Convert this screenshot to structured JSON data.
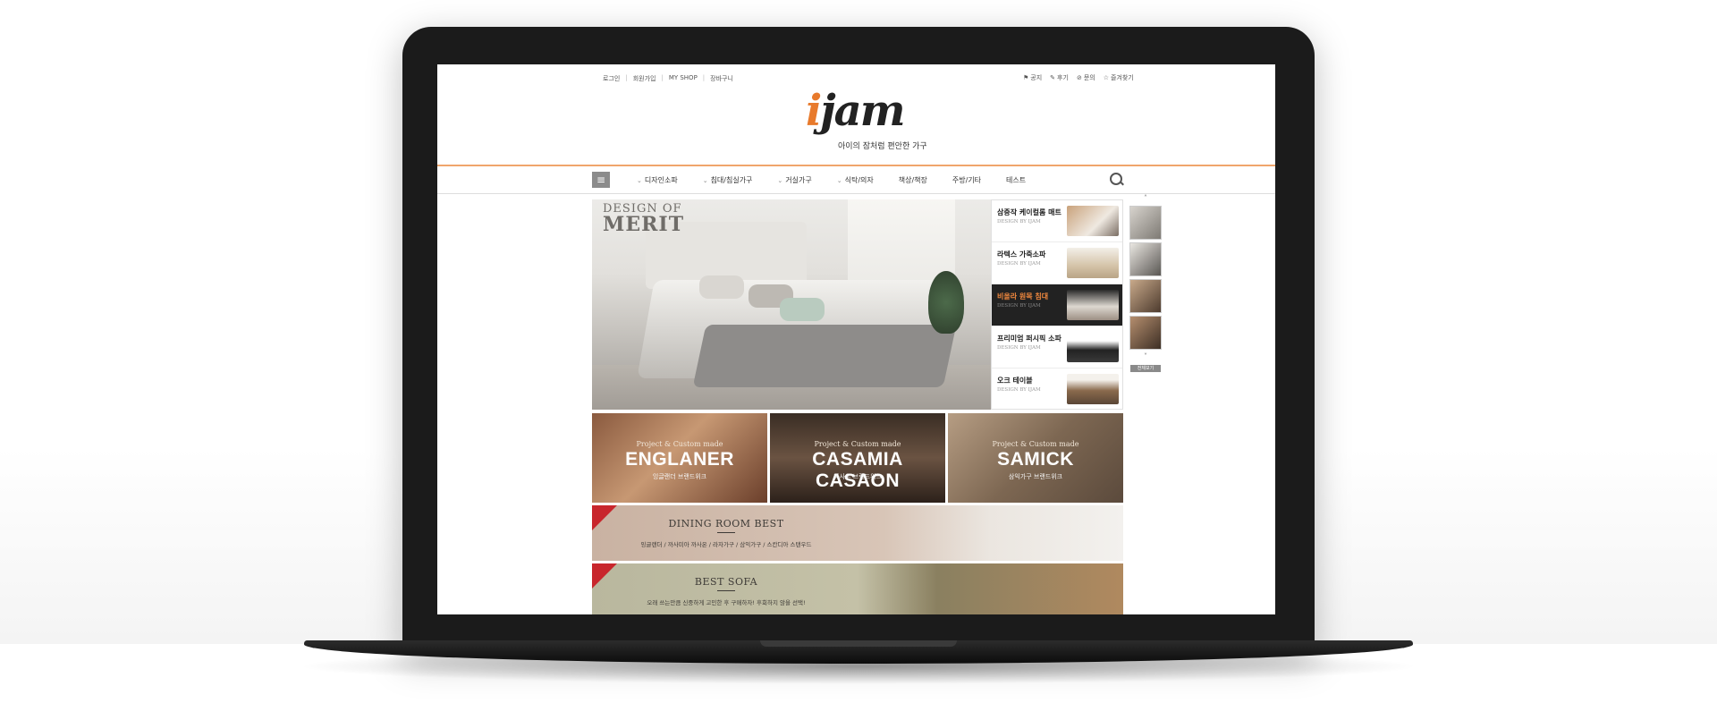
{
  "site": {
    "utility_links": [
      "로그인",
      "회원가입",
      "MY SHOP",
      "장바구니"
    ],
    "top_right": [
      {
        "icon": "notice-icon",
        "label": "공지"
      },
      {
        "icon": "pen-icon",
        "label": "후기"
      },
      {
        "icon": "clip-icon",
        "label": "문의"
      },
      {
        "icon": "star-icon",
        "label": "즐겨찾기"
      }
    ],
    "logo_text": "jam",
    "logo_i": "i",
    "logo_tagline": "아이의 잠처럼 편안한 가구",
    "nav": [
      "디자인소파",
      "침대/침실가구",
      "거실가구",
      "식탁/의자",
      "책상/책장",
      "주방/기타",
      "테스트"
    ],
    "nav_has_chevron": [
      true,
      true,
      true,
      true,
      false,
      false,
      false
    ],
    "hero": {
      "title_line1": "DESIGN OF",
      "title_line2": "MERIT"
    },
    "side_products": [
      {
        "name": "삼중작 케이컬롬 매트",
        "by": "DESIGN BY IJAM",
        "active": false
      },
      {
        "name": "라텍스 가죽소파",
        "by": "DESIGN BY IJAM",
        "active": false
      },
      {
        "name": "비올라 원목 침대",
        "by": "DESIGN BY IJAM",
        "active": true
      },
      {
        "name": "프리미엄 퍼시픽 소파",
        "by": "DESIGN BY IJAM",
        "active": false
      },
      {
        "name": "오크 테이블",
        "by": "DESIGN BY IJAM",
        "active": false
      }
    ],
    "thumb_button": "전체보기",
    "brands": [
      {
        "pre": "Project & Custom made",
        "name": "ENGLANER",
        "sub": "잉글랜더 브랜드위크"
      },
      {
        "pre": "Project & Custom made",
        "name": "CASAMIA CASAON",
        "sub": "까사온 브랜드위크"
      },
      {
        "pre": "Project & Custom made",
        "name": "SAMICK",
        "sub": "삼익가구 브랜드위크"
      }
    ],
    "banner1": {
      "title": "DINING ROOM BEST",
      "sub": "잉글랜더 / 까사미아 까사온 / 라자가구 / 삼익가구 / 스칸디아 스탠우드"
    },
    "banner2": {
      "title": "BEST SOFA",
      "sub": "오래 쓰는만큼 신중하게 고민한 후 구매하자! 후회하지 않을 선택!"
    },
    "colors": {
      "accent": "#e87a2c",
      "nav_line": "#f0a56c",
      "ribbon": "#c8262c"
    }
  }
}
